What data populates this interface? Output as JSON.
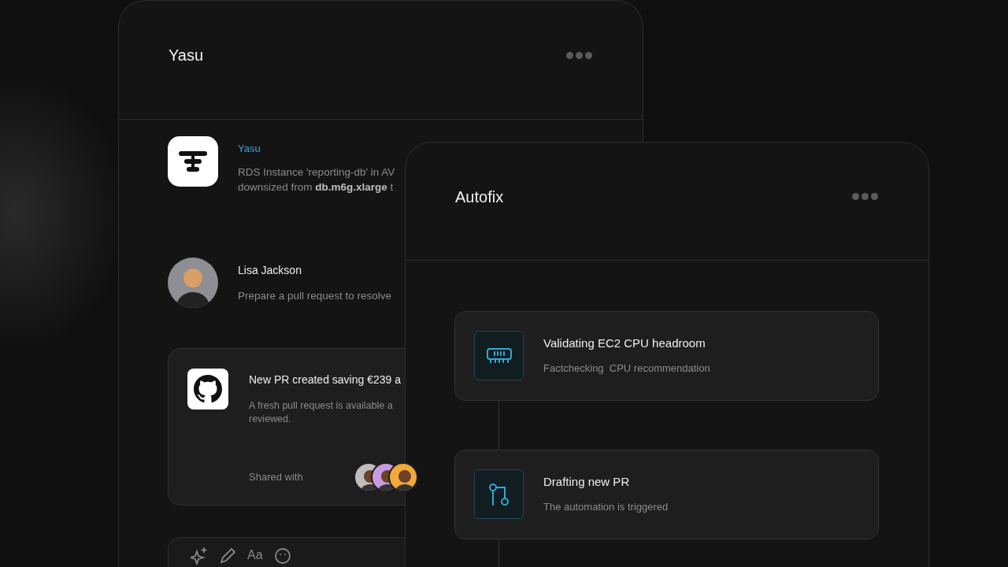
{
  "back_window": {
    "title": "Yasu",
    "messages": [
      {
        "kind": "app",
        "sender": "Yasu",
        "lines": [
          "RDS Instance 'reporting-db' in AV",
          "downsized from **db.m6g.xlarge** t"
        ]
      },
      {
        "kind": "person",
        "sender": "Lisa Jackson",
        "lines": [
          "Prepare a pull request to resolve"
        ]
      }
    ],
    "pr_card": {
      "title": "New PR created saving €239 a",
      "lines": [
        "A fresh pull request is available a",
        "reviewed."
      ],
      "shared_label": "Shared with",
      "shared_avatars": [
        {
          "color": "#bdbdbd"
        },
        {
          "color": "#c79be0"
        },
        {
          "color": "#f0a93a"
        }
      ]
    },
    "composer": {
      "tools": [
        {
          "kind": "sparkle"
        },
        {
          "kind": "pen"
        },
        {
          "kind": "font",
          "label": "Aa"
        },
        {
          "kind": "emoji"
        }
      ]
    }
  },
  "front_window": {
    "title": "Autofix",
    "steps": [
      {
        "kind": "memory",
        "title": "Validating EC2 CPU headroom",
        "subtitle": "Factchecking  CPU recommendation"
      },
      {
        "kind": "branch",
        "title": "Drafting new PR",
        "subtitle": "The automation is triggered"
      }
    ]
  }
}
